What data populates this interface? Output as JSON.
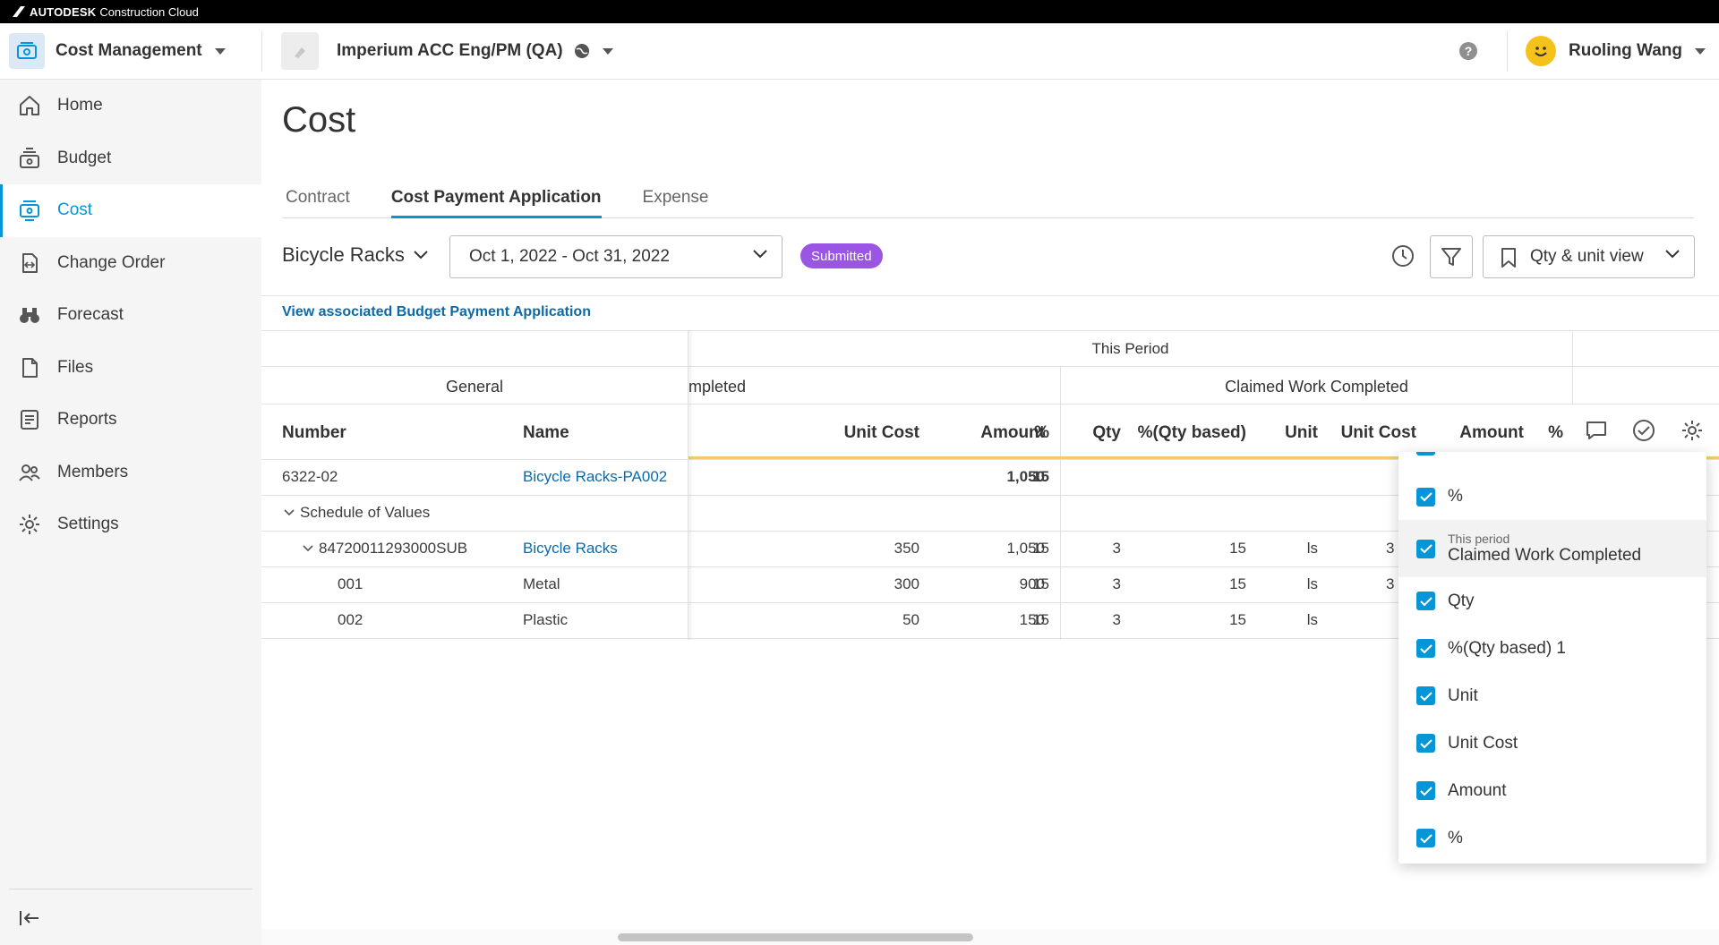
{
  "brand": {
    "name": "AUTODESK",
    "product": "Construction Cloud"
  },
  "header": {
    "module": "Cost Management",
    "project": "Imperium ACC Eng/PM (QA)",
    "help": "?",
    "user": "Ruoling Wang"
  },
  "sidebar": {
    "items": [
      {
        "label": "Home",
        "icon": "home-icon"
      },
      {
        "label": "Budget",
        "icon": "budget-icon"
      },
      {
        "label": "Cost",
        "icon": "cost-icon"
      },
      {
        "label": "Change Order",
        "icon": "change-order-icon"
      },
      {
        "label": "Forecast",
        "icon": "binoculars-icon"
      },
      {
        "label": "Files",
        "icon": "file-icon"
      },
      {
        "label": "Reports",
        "icon": "report-icon"
      },
      {
        "label": "Members",
        "icon": "members-icon"
      },
      {
        "label": "Settings",
        "icon": "gear-icon"
      }
    ]
  },
  "page": {
    "title": "Cost",
    "tabs": [
      "Contract",
      "Cost Payment Application",
      "Expense"
    ],
    "active_tab": "Cost Payment Application"
  },
  "toolbar": {
    "selector": "Bicycle Racks",
    "date_range": "Oct 1, 2022 - Oct 31, 2022",
    "status": "Submitted",
    "view": "Qty & unit view",
    "assoc_link": "View associated Budget Payment Application"
  },
  "table": {
    "group_headers": {
      "this_period": "This Period",
      "general": "General",
      "completed_partial": "mpleted",
      "claimed": "Claimed Work Completed"
    },
    "columns": {
      "number": "Number",
      "name": "Name",
      "unit_cost": "Unit Cost",
      "amount": "Amount",
      "pct": "%",
      "qty": "Qty",
      "pct_qty": "%(Qty based)",
      "unit": "Unit",
      "unit_cost2": "Unit Cost",
      "amount2": "Amount",
      "pct2": "%"
    },
    "rows": [
      {
        "number": "6322-02",
        "name": "Bicycle Racks-PA002",
        "unit_cost": "",
        "amount": "1,050",
        "pct": "15",
        "qty": "",
        "pct_qty": "",
        "unit": "",
        "unit_cost2": ""
      },
      {
        "number": "Schedule of Values",
        "name": "",
        "unit_cost": "",
        "amount": "",
        "pct": "",
        "qty": "",
        "pct_qty": "",
        "unit": "",
        "unit_cost2": ""
      },
      {
        "number": "84720011293000SUB",
        "name": "Bicycle Racks",
        "unit_cost": "350",
        "amount": "1,050",
        "pct": "15",
        "qty": "3",
        "pct_qty": "15",
        "unit": "ls",
        "unit_cost2": "3"
      },
      {
        "number": "001",
        "name": "Metal",
        "unit_cost": "300",
        "amount": "900",
        "pct": "15",
        "qty": "3",
        "pct_qty": "15",
        "unit": "ls",
        "unit_cost2": "3"
      },
      {
        "number": "002",
        "name": "Plastic",
        "unit_cost": "50",
        "amount": "150",
        "pct": "15",
        "qty": "3",
        "pct_qty": "15",
        "unit": "ls",
        "unit_cost2": ""
      }
    ]
  },
  "column_menu": {
    "items": [
      {
        "label": "%",
        "sub": ""
      },
      {
        "label": "Claimed Work Completed",
        "sub": "This period"
      },
      {
        "label": "Qty",
        "sub": ""
      },
      {
        "label": "%(Qty based) 1",
        "sub": ""
      },
      {
        "label": "Unit",
        "sub": ""
      },
      {
        "label": "Unit Cost",
        "sub": ""
      },
      {
        "label": "Amount",
        "sub": ""
      },
      {
        "label": "%",
        "sub": ""
      }
    ]
  },
  "colors": {
    "accent": "#0696d7",
    "badge": "#9b55e5",
    "link": "#0b6aa8",
    "sidebar_bg": "#f5f5f5"
  }
}
